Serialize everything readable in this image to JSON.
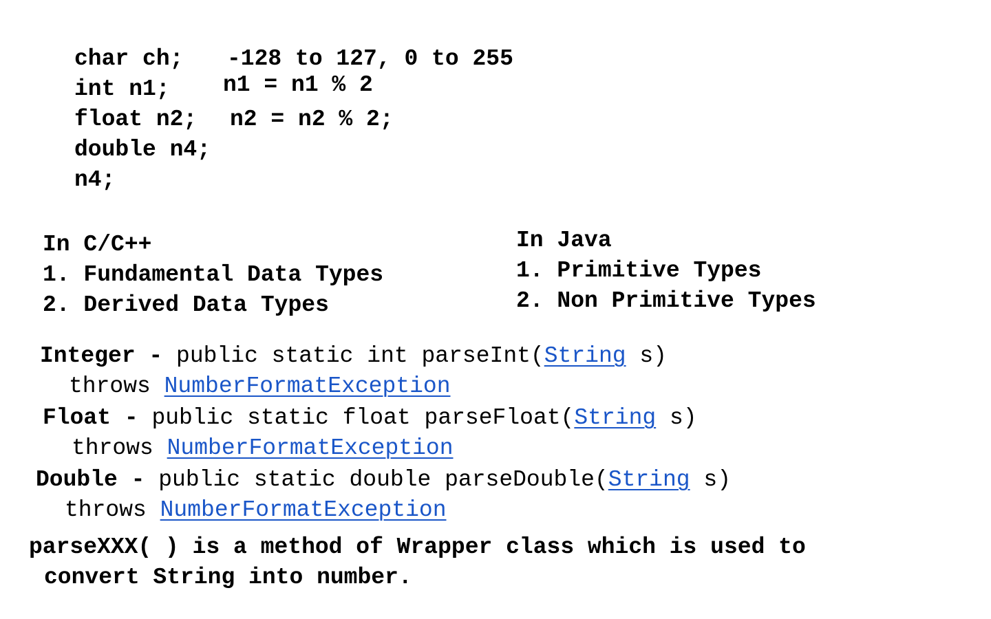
{
  "code": {
    "ch_decl": "char ch;",
    "ch_range": "-128 to 127, 0 to 255",
    "n1_decl": "int n1;",
    "n1_expr": "n1 = n1 % 2",
    "n2_decl": "float n2;",
    "n2_expr": "n2 = n2 % 2;",
    "n4_decl": "double n4;",
    "n4_stmt": "n4;"
  },
  "cpp": {
    "heading": "In C/C++",
    "items": [
      "1. Fundamental Data Types",
      "2. Derived Data Types"
    ]
  },
  "java": {
    "heading": "In Java",
    "items": [
      "1. Primitive Types",
      "2. Non Primitive Types"
    ]
  },
  "methods": [
    {
      "cls": "Integer",
      "sep": " - ",
      "sig": "public static int parseInt(",
      "param_type": "String",
      "param_tail": " s)",
      "throws": "throws ",
      "exception": "NumberFormatException"
    },
    {
      "cls": "Float",
      "sep": " - ",
      "sig": "public static float parseFloat(",
      "param_type": "String",
      "param_tail": " s)",
      "throws": "throws ",
      "exception": "NumberFormatException"
    },
    {
      "cls": "Double",
      "sep": " - ",
      "sig": "public static double parseDouble(",
      "param_type": "String",
      "param_tail": " s)",
      "throws": "throws ",
      "exception": "NumberFormatException"
    }
  ],
  "summary": {
    "line1": "parseXXX( ) is a method of Wrapper class which is used to",
    "line2": "convert String into number."
  },
  "colors": {
    "text": "#000000",
    "link": "#1a56c8",
    "background": "#ffffff"
  }
}
